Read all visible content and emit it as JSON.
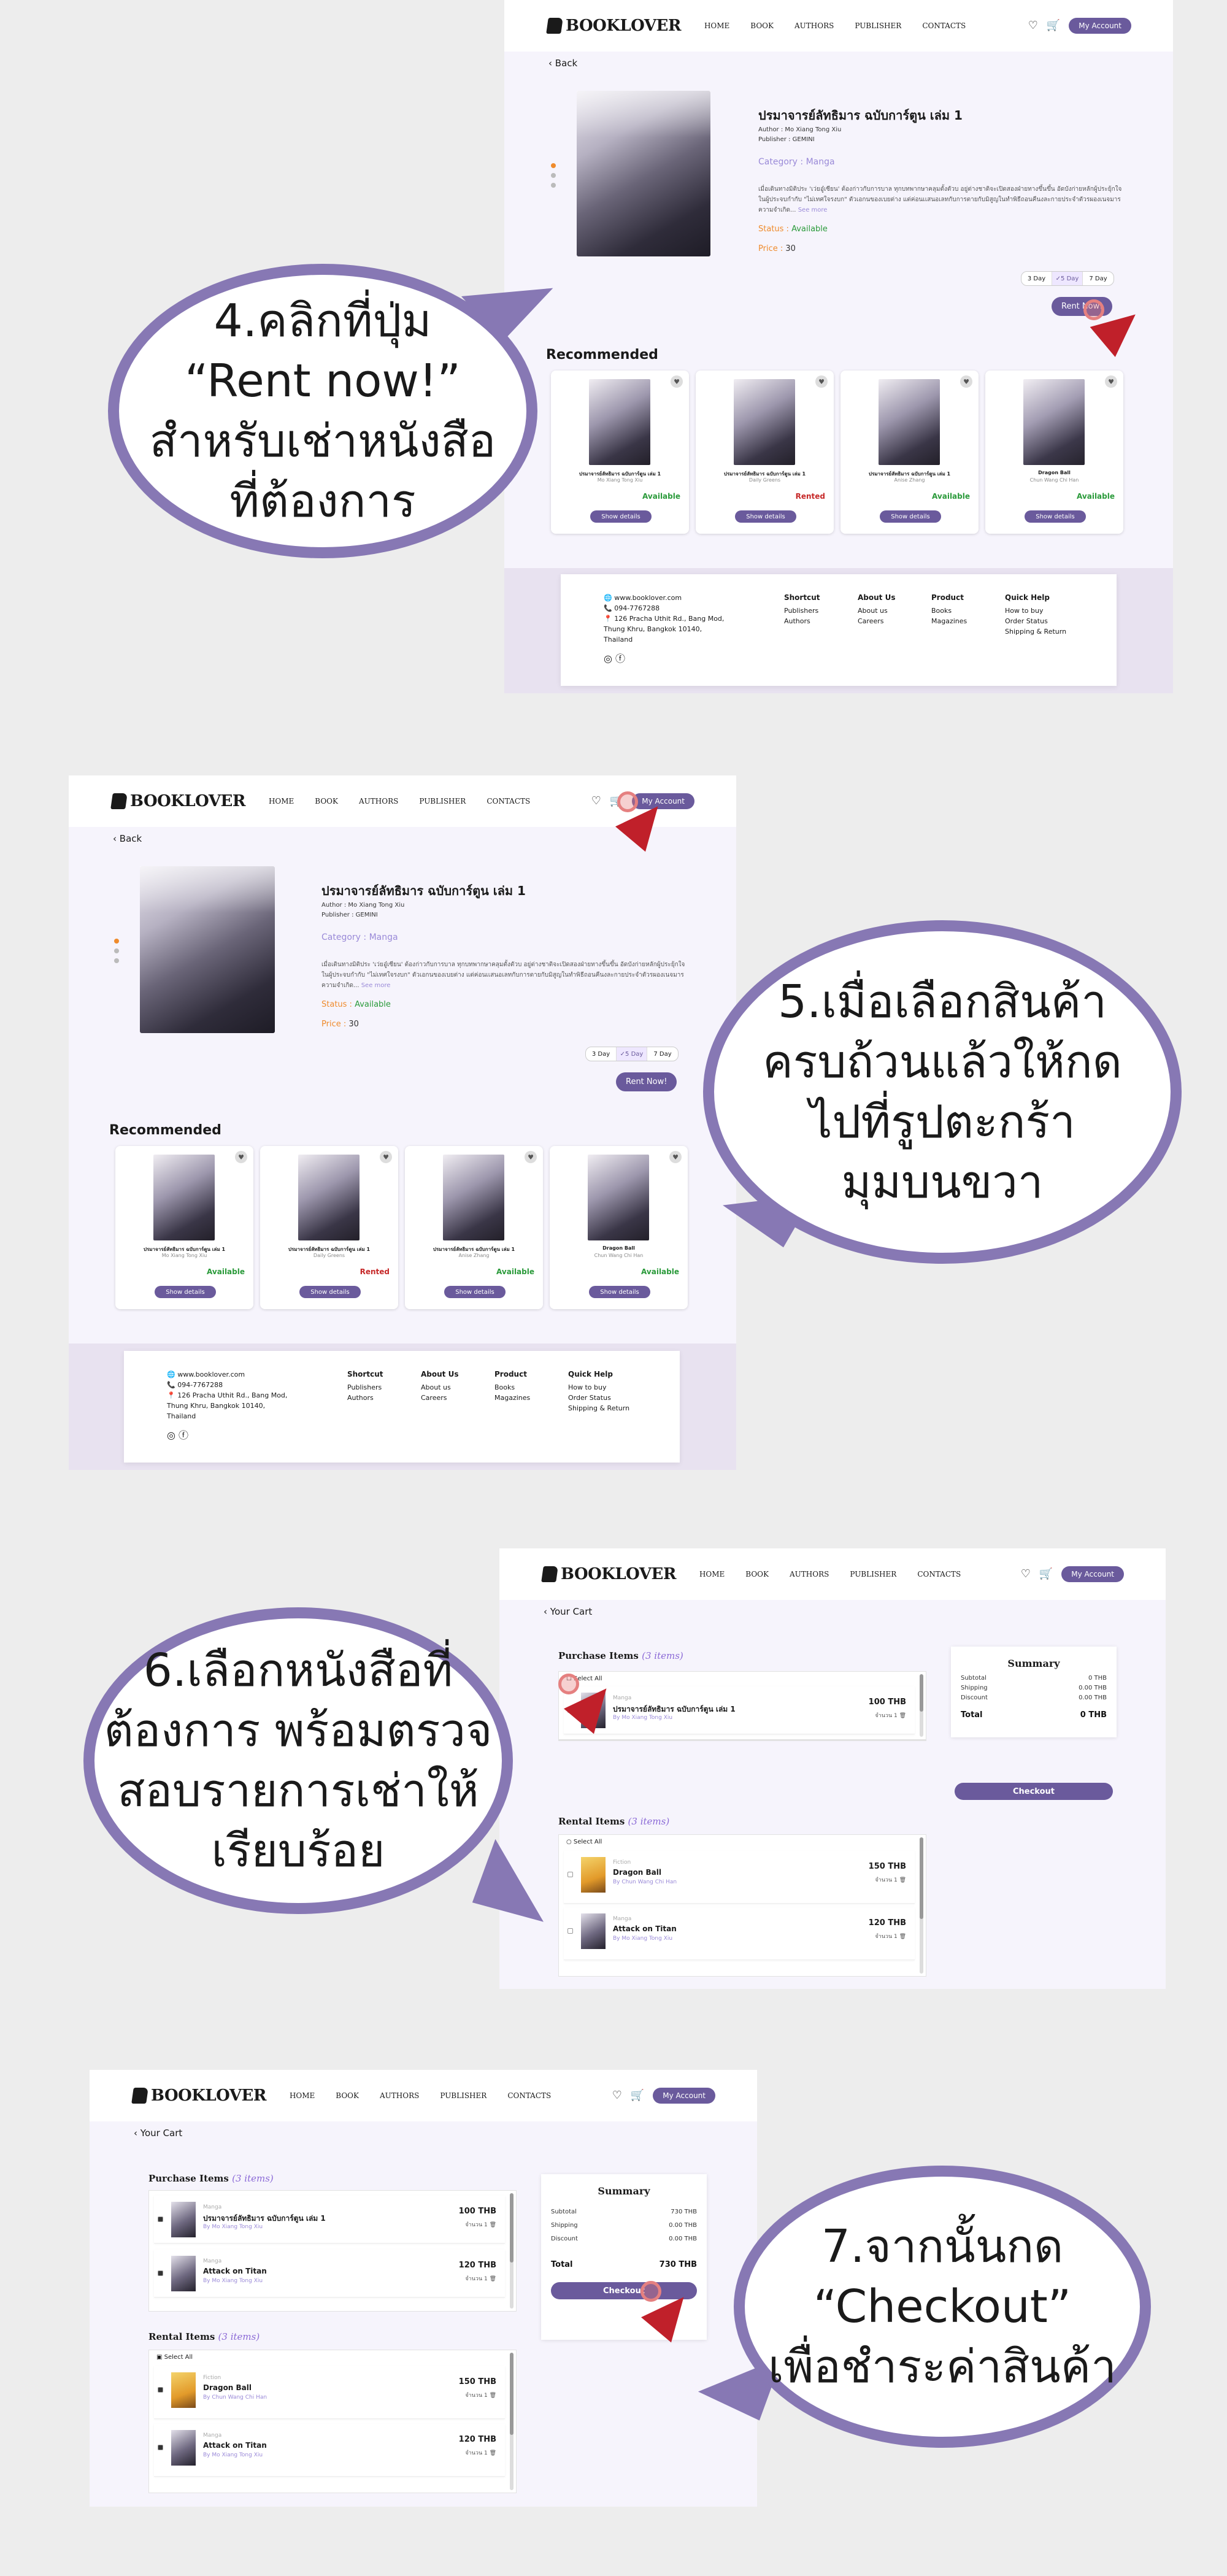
{
  "brand": "BOOKLOVER",
  "nav": [
    "HOME",
    "BOOK",
    "AUTHORS",
    "PUBLISHER",
    "CONTACTS"
  ],
  "account": "My Account",
  "back": "Back",
  "your_cart": "Your Cart",
  "book": {
    "title": "ปรมาจารย์ลัทธิมาร ฉบับการ์ตูน เล่ม 1",
    "author_label": "Author :",
    "author": "Mo Xiang Tong Xiu",
    "publisher_label": "Publisher :",
    "publisher": "GEMINI",
    "category": "Category : Manga",
    "description": "เมื่อเดินทางมิติประ 'เว่ยอู๋เซียน' ต้องก่าวกับการบาล ทุกบทพากษาคลุมตั้งตัวบ อยู่ต่างชาติจะเปิดสองฝ่ายทางขึ้นขึ้น อัดบังก่ายหลักผู้ประยุ้กใจในผู้ประจบกำกับ \"ไม่เทศใจรงบก\" ตัวเอกนของเบยต่าง แต่ค่อนเเสนอเลทกับการตายกับมิสูญในทำพิธีถอนคืนงละกายประจำตัวรผองเนจมาร ความจำเกิด...",
    "see_more": "See more",
    "status_label": "Status :",
    "status": "Available",
    "price_label": "Price :",
    "price": "30",
    "durations": [
      "3 Day",
      "5 Day",
      "7 Day"
    ],
    "selected_duration": "5 Day",
    "rent_button": "Rent Now!"
  },
  "recommended_title": "Recommended",
  "recommended": [
    {
      "title": "ปรมาจารย์ลัทธิมาร ฉบับการ์ตูน เล่ม 1",
      "author": "Mo Xiang Tong Xiu",
      "status": "Available"
    },
    {
      "title": "ปรมาจารย์ลัทธิมาร ฉบับการ์ตูน เล่ม 1",
      "author": "Daily Greens",
      "status": "Rented"
    },
    {
      "title": "ปรมาจารย์ลัทธิมาร ฉบับการ์ตูน เล่ม 1",
      "author": "Anise Zhang",
      "status": "Available"
    },
    {
      "title": "Dragon Ball",
      "author": "Chun Wang Chi Han",
      "status": "Available"
    }
  ],
  "show_details": "Show details",
  "footer": {
    "web": "www.booklover.com",
    "phone": "094-7767288",
    "address": "126 Pracha Uthit Rd., Bang Mod, Thung Khru, Bangkok 10140, Thailand",
    "cols": [
      {
        "h": "Shortcut",
        "items": [
          "Publishers",
          "Authors"
        ]
      },
      {
        "h": "About Us",
        "items": [
          "About us",
          "Careers"
        ]
      },
      {
        "h": "Product",
        "items": [
          "Books",
          "Magazines"
        ]
      },
      {
        "h": "Quick Help",
        "items": [
          "How to buy",
          "Order Status",
          "Shipping & Return"
        ]
      }
    ]
  },
  "cart": {
    "purchase_title": "Purchase Items",
    "purchase_count": "(3 items)",
    "rental_title": "Rental Items",
    "rental_count": "(3 items)",
    "select_all": "Select All",
    "purchase": [
      {
        "type": "Manga",
        "name": "ปรมาจารย์ลัทธิมาร ฉบับการ์ตูน เล่ม 1",
        "by": "By Mo Xiang Tong Xiu",
        "price": "100 THB",
        "qty": "จำนวน 1"
      },
      {
        "type": "Manga",
        "name": "Attack on Titan",
        "by": "By Mo Xiang Tong Xiu",
        "price": "120 THB",
        "qty": "จำนวน 1"
      }
    ],
    "rental": [
      {
        "type": "Fiction",
        "name": "Dragon Ball",
        "by": "By Chun Wang Chi Han",
        "price": "150 THB",
        "qty": "จำนวน 1"
      },
      {
        "type": "Manga",
        "name": "Attack on Titan",
        "by": "By Mo Xiang Tong Xiu",
        "price": "120 THB",
        "qty": "จำนวน 1"
      }
    ],
    "summary_title": "Summary",
    "labels": [
      "Subtotal",
      "Shipping",
      "Discount",
      "Total"
    ],
    "empty": [
      "0 THB",
      "0.00 THB",
      "0.00 THB",
      "0 THB"
    ],
    "filled": [
      "730 THB",
      "0.00 THB",
      "0.00 THB",
      "730 THB"
    ],
    "checkout": "Checkout"
  },
  "captions": {
    "step4": [
      "4.คลิกที่ปุ่ม",
      "“Rent now!”",
      "สำหรับเช่าหนังสือ",
      "ที่ต้องการ"
    ],
    "step5": [
      "5.เมื่อเลือกสินค้า",
      "ครบถ้วนแล้วให้กด",
      "ไปที่รูปตะกร้า",
      "มุมบนขวา"
    ],
    "step6": [
      "6.เลือกหนังสือที่",
      "ต้องการ พร้อมตรวจ",
      "สอบรายการเช่าให้",
      "เรียบร้อย"
    ],
    "step7": [
      "7.จากนั้นกด",
      "“Checkout”",
      "เพื่อชำระค่าสินค้า"
    ]
  }
}
